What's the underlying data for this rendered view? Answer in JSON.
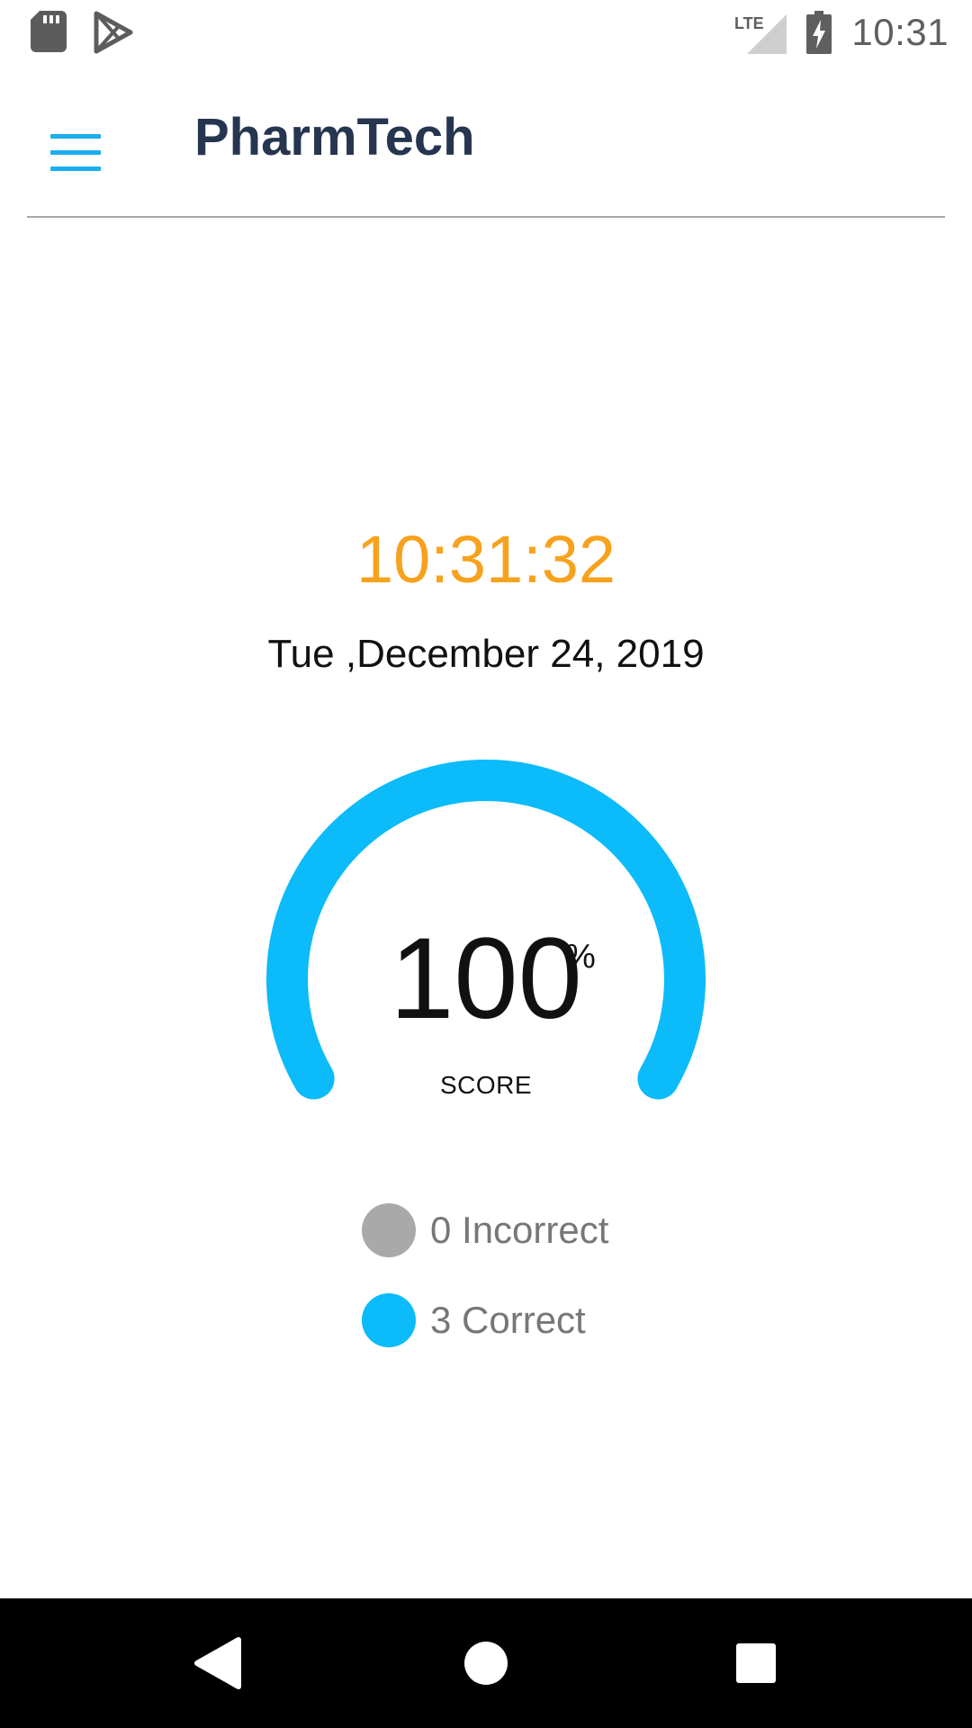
{
  "status_bar": {
    "time": "10:31",
    "network_label": "LTE",
    "icons": [
      "sd-card-icon",
      "play-store-icon",
      "lte-signal-icon",
      "battery-charging-icon"
    ]
  },
  "app_bar": {
    "title": "PharmTech",
    "menu_icon": "hamburger-menu-icon"
  },
  "clock": {
    "time": "10:31:32",
    "date": "Tue ,December 24, 2019"
  },
  "score": {
    "value": "100",
    "unit": "%",
    "label": "SCORE",
    "fraction": 1.0
  },
  "legend": {
    "incorrect": "0 Incorrect",
    "correct": "3 Correct"
  },
  "colors": {
    "accent": "#0bbbfa",
    "clock": "#f7a21e",
    "incorrect": "#a9a9a9",
    "title": "#263550"
  },
  "nav_bar": {
    "icons": [
      "back-icon",
      "home-icon",
      "recents-icon"
    ]
  }
}
